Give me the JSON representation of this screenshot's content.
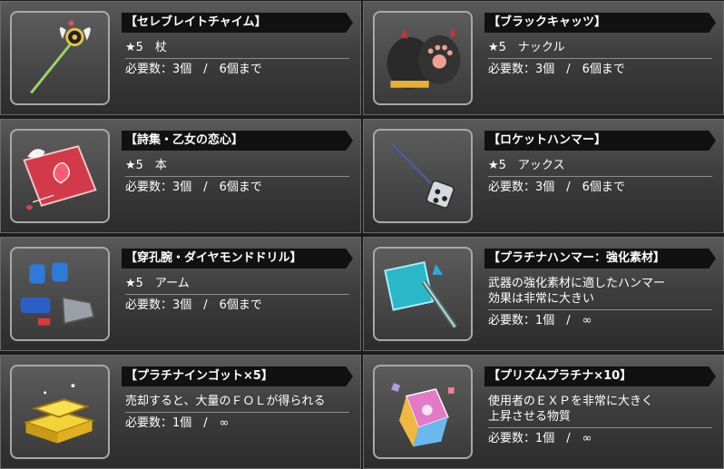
{
  "items": [
    {
      "title": "【セレブレイトチャイム】",
      "line1": "★5　杖",
      "req": "必要数：3個　/　6個まで",
      "icon": "staff-icon"
    },
    {
      "title": "【ブラックキャッツ】",
      "line1": "★5　ナックル",
      "req": "必要数：3個　/　6個まで",
      "icon": "cat-paw-glove-icon"
    },
    {
      "title": "【詩集・乙女の恋心】",
      "line1": "★5　本",
      "req": "必要数：3個　/　6個まで",
      "icon": "book-icon"
    },
    {
      "title": "【ロケットハンマー】",
      "line1": "★5　アックス",
      "req": "必要数：3個　/　6個まで",
      "icon": "rocket-hammer-icon"
    },
    {
      "title": "【穿孔腕・ダイヤモンドドリル】",
      "line1": "★5　アーム",
      "req": "必要数：3個　/　6個まで",
      "icon": "drill-arm-icon"
    },
    {
      "title": "【プラチナハンマー：強化素材】",
      "line1": "武器の強化素材に適したハンマー",
      "line2": "効果は非常に大きい",
      "req": "必要数：1個　/　∞",
      "icon": "platinum-hammer-icon"
    },
    {
      "title": "【プラチナインゴット×5】",
      "line1": "売却すると、大量のＦＯＬが得られる",
      "req": "必要数：1個　/　∞",
      "icon": "gold-ingot-icon"
    },
    {
      "title": "【プリズムプラチナ×10】",
      "line1": "使用者のＥＸＰを非常に大きく",
      "line2": "上昇させる物質",
      "req": "必要数：1個　/　∞",
      "icon": "prism-crystal-icon"
    }
  ]
}
